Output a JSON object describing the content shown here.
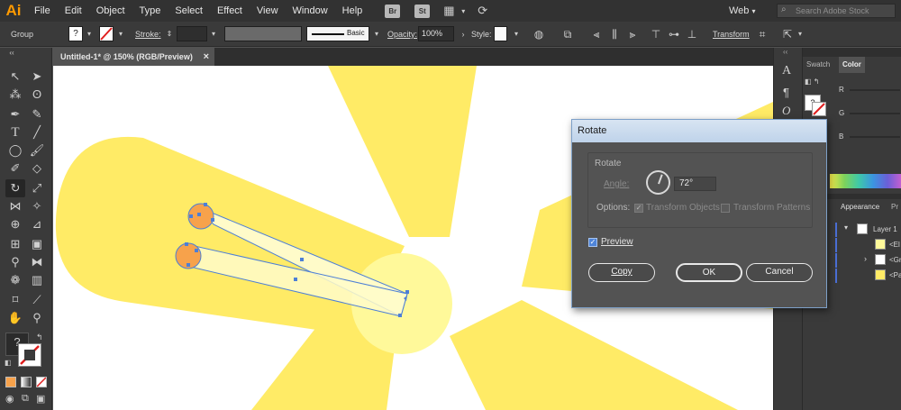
{
  "app": {
    "logo": "Ai"
  },
  "menu": {
    "items": [
      "File",
      "Edit",
      "Object",
      "Type",
      "Select",
      "Effect",
      "View",
      "Window",
      "Help"
    ],
    "bridge": "Br",
    "stock": "St"
  },
  "workspace": {
    "label": "Web"
  },
  "search": {
    "placeholder": "Search Adobe Stock"
  },
  "control": {
    "selection": "Group",
    "stroke_label": "Stroke:",
    "brush": "Basic",
    "opacity_label": "Opacity:",
    "opacity_value": "100%",
    "style_label": "Style:",
    "transform_label": "Transform"
  },
  "document": {
    "tab_title": "Untitled-1* @ 150% (RGB/Preview)",
    "close": "×"
  },
  "right_panel": {
    "tabs": [
      "Swatch",
      "Color"
    ],
    "channels": [
      "R",
      "G",
      "B"
    ],
    "layers_tabs": [
      "Appearance",
      "Pr"
    ],
    "layer_name": "Layer 1",
    "layer_items": [
      "<El",
      "<Gr",
      "<Pa"
    ]
  },
  "dialog": {
    "title": "Rotate",
    "group_title": "Rotate",
    "angle_label": "Angle:",
    "angle_value": "72°",
    "options_label": "Options:",
    "transform_objects": "Transform Objects",
    "transform_patterns": "Transform Patterns",
    "preview_label": "Preview",
    "copy_label": "Copy",
    "ok_label": "OK",
    "cancel_label": "Cancel"
  },
  "colors": {
    "flower_yellow": "#ffeb66",
    "center_yellow": "#fff99a",
    "circle_orange": "#f7a24b",
    "selection_blue": "#4d7fd6"
  }
}
